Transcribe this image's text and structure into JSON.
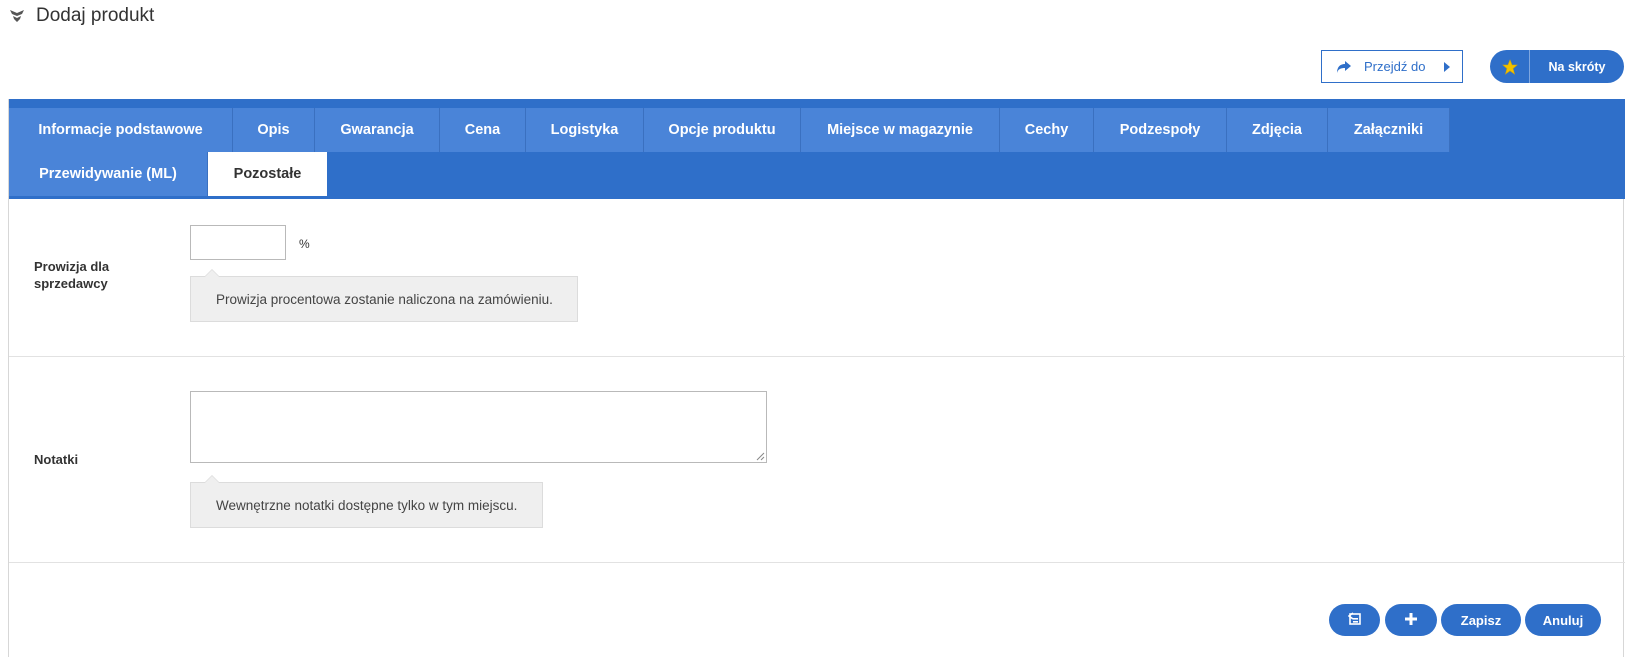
{
  "header": {
    "title": "Dodaj produkt",
    "icon": "product-hand-icon"
  },
  "actions": {
    "goto_label": "Przejdź do",
    "shortcuts_label": "Na skróty"
  },
  "tabs": [
    "Informacje podstawowe",
    "Opis",
    "Gwarancja",
    "Cena",
    "Logistyka",
    "Opcje produktu",
    "Miejsce w magazynie",
    "Cechy",
    "Podzespoły",
    "Zdjęcia",
    "Załączniki",
    "Przewidywanie (ML)",
    "Pozostałe"
  ],
  "active_tab": "Pozostałe",
  "form": {
    "commission": {
      "label": "Prowizja dla sprzedawcy",
      "value": "",
      "unit": "%",
      "hint": "Prowizja procentowa zostanie naliczona na zamówieniu."
    },
    "notes": {
      "label": "Notatki",
      "value": "",
      "hint": "Wewnętrzne notatki dostępne tylko w tym miejscu."
    }
  },
  "footer": {
    "save_label": "Zapisz",
    "cancel_label": "Anuluj"
  },
  "colors": {
    "accent": "#2f6fc9",
    "tab": "#4a84d8",
    "star": "#f2c200"
  }
}
